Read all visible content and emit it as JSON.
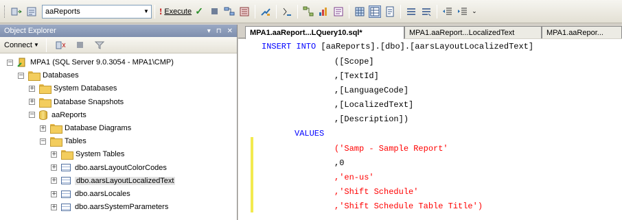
{
  "toolbar": {
    "database": "aaReports",
    "execute_label": "Execute"
  },
  "object_explorer": {
    "title": "Object Explorer",
    "controls": [
      "▾",
      "⊓",
      "✕"
    ],
    "connect_label": "Connect",
    "tree": [
      {
        "label": "MPA1 (SQL Server 9.0.3054 - MPA1\\CMP)",
        "pm": "−",
        "icon": "server",
        "indent": 0
      },
      {
        "label": "Databases",
        "pm": "−",
        "icon": "folder",
        "indent": 1
      },
      {
        "label": "System Databases",
        "pm": "+",
        "icon": "folder",
        "indent": 2
      },
      {
        "label": "Database Snapshots",
        "pm": "+",
        "icon": "folder",
        "indent": 2
      },
      {
        "label": "aaReports",
        "pm": "−",
        "icon": "database",
        "indent": 2
      },
      {
        "label": "Database Diagrams",
        "pm": "+",
        "icon": "folder",
        "indent": 3
      },
      {
        "label": "Tables",
        "pm": "−",
        "icon": "folder",
        "indent": 3
      },
      {
        "label": "System Tables",
        "pm": "+",
        "icon": "folder",
        "indent": 4
      },
      {
        "label": "dbo.aarsLayoutColorCodes",
        "pm": "+",
        "icon": "table",
        "indent": 4
      },
      {
        "label": "dbo.aarsLayoutLocalizedText",
        "pm": "+",
        "icon": "table",
        "indent": 4,
        "selected": true
      },
      {
        "label": "dbo.aarsLocales",
        "pm": "+",
        "icon": "table",
        "indent": 4
      },
      {
        "label": "dbo.aarsSystemParameters",
        "pm": "+",
        "icon": "table",
        "indent": 4
      }
    ]
  },
  "tabs": [
    {
      "label": "MPA1.aaReport...LQuery10.sql*",
      "active": true
    },
    {
      "label": "MPA1.aaReport...LocalizedText",
      "active": false
    },
    {
      "label": "MPA1.aaRepor...",
      "active": false
    }
  ],
  "sql": {
    "line1_kw": "INSERT INTO",
    "line1_rest": " [aaReports].[dbo].[aarsLayoutLocalizedText]",
    "cols": [
      "([Scope]",
      ",[TextId]",
      ",[LanguageCode]",
      ",[LocalizedText]",
      ",[Description])"
    ],
    "values_kw": "VALUES",
    "v1": "('Samp - Sample Report'",
    "v2": ",0",
    "v3": ",'en-us'",
    "v4": ",'Shift Schedule'",
    "v5": ",'Shift Schedule Table Title')"
  }
}
